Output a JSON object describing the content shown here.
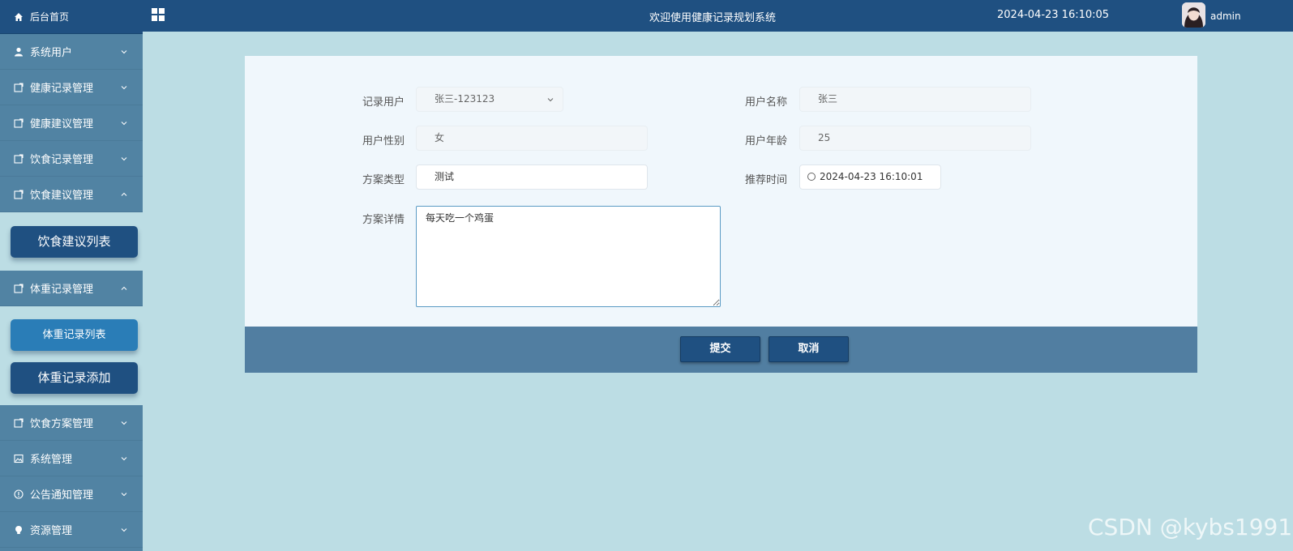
{
  "sidebar": {
    "home": "后台首页",
    "menus": [
      {
        "label": "系统用户"
      },
      {
        "label": "健康记录管理"
      },
      {
        "label": "健康建议管理"
      },
      {
        "label": "饮食记录管理"
      },
      {
        "label": "饮食建议管理"
      },
      {
        "label": "体重记录管理"
      },
      {
        "label": "饮食方案管理"
      },
      {
        "label": "系统管理"
      },
      {
        "label": "公告通知管理"
      },
      {
        "label": "资源管理"
      }
    ],
    "diet_advice_sub": [
      "饮食建议列表"
    ],
    "weight_sub": [
      "体重记录列表",
      "体重记录添加"
    ]
  },
  "header": {
    "title": "欢迎使用健康记录规划系统",
    "time": "2024-04-23 16:10:05",
    "user": "admin"
  },
  "form": {
    "record_user_label": "记录用户",
    "record_user_value": "张三-123123",
    "user_name_label": "用户名称",
    "user_name_value": "张三",
    "gender_label": "用户性别",
    "gender_value": "女",
    "age_label": "用户年龄",
    "age_value": "25",
    "plan_type_label": "方案类型",
    "plan_type_value": "测试",
    "time_label": "推荐时间",
    "time_value": "2024-04-23 16:10:01",
    "detail_label": "方案详情",
    "detail_value": "每天吃一个鸡蛋",
    "submit": "提交",
    "cancel": "取消"
  },
  "watermark": "CSDN @kybs1991",
  "colors": {
    "header": "#1f5081",
    "sidebar": "#5183a3",
    "page_bg": "#bcdde4",
    "card_bg": "#f0f7fc",
    "button": "#1f5081"
  }
}
